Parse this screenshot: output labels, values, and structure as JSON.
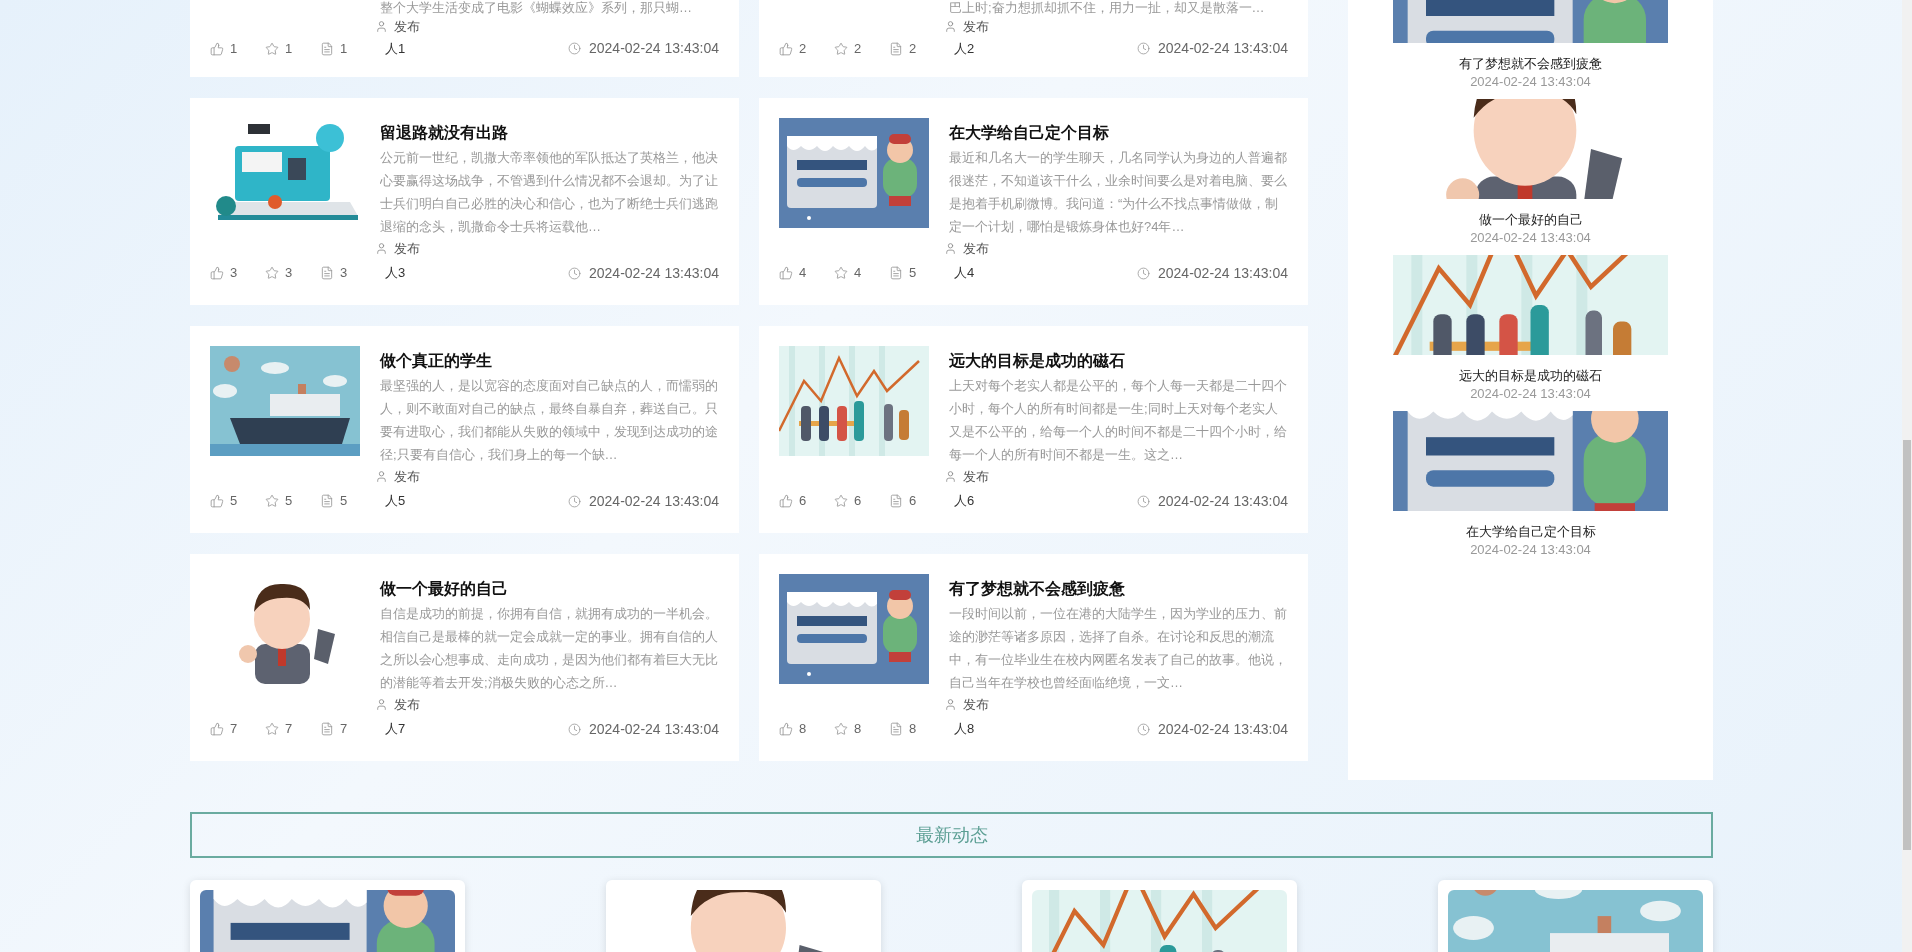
{
  "articles": [
    {
      "excerpt": "整个大学生活变成了电影《蝴蝶效应》系列，那只蝴…",
      "byline": "发布",
      "likes": "1",
      "favorites": "1",
      "comments": "1",
      "author": "人1",
      "date": "2024-02-24 13:43:04"
    },
    {
      "excerpt": "巴上时;奋力想抓却抓不住，用力一扯，却又是散落一…",
      "byline": "发布",
      "likes": "2",
      "favorites": "2",
      "comments": "2",
      "author": "人2",
      "date": "2024-02-24 13:43:04"
    },
    {
      "title": "留退路就没有出路",
      "excerpt": "公元前一世纪，凯撒大帝率领他的军队抵达了英格兰，他决心要赢得这场战争，不管遇到什么情况都不会退却。为了让士兵们明白自己必胜的决心和信心，也为了断绝士兵们逃跑退缩的念头，凯撒命令士兵将运载他…",
      "byline": "发布",
      "likes": "3",
      "favorites": "3",
      "comments": "3",
      "author": "人3",
      "date": "2024-02-24 13:43:04"
    },
    {
      "title": "在大学给自己定个目标",
      "excerpt": "最近和几名大一的学生聊天，几名同学认为身边的人普遍都很迷茫，不知道该干什么，业余时间要么是对着电脑、要么是抱着手机刷微博。我问道：“为什么不找点事情做做，制定一个计划，哪怕是锻炼身体也好?4年…",
      "byline": "发布",
      "likes": "4",
      "favorites": "4",
      "comments": "5",
      "author": "人4",
      "date": "2024-02-24 13:43:04"
    },
    {
      "title": "做个真正的学生",
      "excerpt": "最坚强的人，是以宽容的态度面对自己缺点的人，而懦弱的人，则不敢面对自己的缺点，最终自暴自弃，葬送自己。只要有进取心，我们都能从失败的领域中，发现到达成功的途径;只要有自信心，我们身上的每一个缺…",
      "byline": "发布",
      "likes": "5",
      "favorites": "5",
      "comments": "5",
      "author": "人5",
      "date": "2024-02-24 13:43:04"
    },
    {
      "title": "远大的目标是成功的磁石",
      "excerpt": "上天对每个老实人都是公平的，每个人每一天都是二十四个小时，每个人的所有时间都是一生;同时上天对每个老实人又是不公平的，给每一个人的时间不都是二十四个小时，给每一个人的所有时间不都是一生。这之…",
      "byline": "发布",
      "likes": "6",
      "favorites": "6",
      "comments": "6",
      "author": "人6",
      "date": "2024-02-24 13:43:04"
    },
    {
      "title": "做一个最好的自己",
      "excerpt": "自信是成功的前提，你拥有自信，就拥有成功的一半机会。相信自己是最棒的就一定会成就一定的事业。拥有自信的人之所以会心想事成、走向成功，是因为他们都有着巨大无比的潜能等着去开发;消极失败的心态之所…",
      "byline": "发布",
      "likes": "7",
      "favorites": "7",
      "comments": "7",
      "author": "人7",
      "date": "2024-02-24 13:43:04"
    },
    {
      "title": "有了梦想就不会感到疲惫",
      "excerpt": "一段时间以前，一位在港的大陆学生，因为学业的压力、前途的渺茫等诸多原因，选择了自杀。在讨论和反思的潮流中，有一位毕业生在校内网匿名发表了自己的故事。他说，自己当年在学校也曾经面临绝境，一文…",
      "byline": "发布",
      "likes": "8",
      "favorites": "8",
      "comments": "8",
      "author": "人8",
      "date": "2024-02-24 13:43:04"
    }
  ],
  "sidebar": {
    "items": [
      {
        "title": "有了梦想就不会感到疲惫",
        "date": "2024-02-24 13:43:04"
      },
      {
        "title": "做一个最好的自己",
        "date": "2024-02-24 13:43:04"
      },
      {
        "title": "远大的目标是成功的磁石",
        "date": "2024-02-24 13:43:04"
      },
      {
        "title": "在大学给自己定个目标",
        "date": "2024-02-24 13:43:04"
      }
    ]
  },
  "latest": {
    "title": "最新动态"
  }
}
